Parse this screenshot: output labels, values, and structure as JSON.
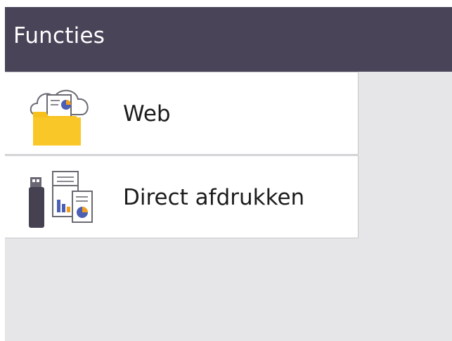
{
  "header": {
    "title": "Functies"
  },
  "menu": {
    "items": [
      {
        "label": "Web",
        "icon": "web-cloud-folder-icon"
      },
      {
        "label": "Direct afdrukken",
        "icon": "usb-direct-print-icon"
      }
    ]
  },
  "colors": {
    "header_bg": "#4a4459",
    "screen_bg": "#e6e6e8",
    "folder": "#f7c01f",
    "pie_accent": "#4c5fb5",
    "pie_orange": "#f2a01c",
    "usb": "#454150"
  }
}
